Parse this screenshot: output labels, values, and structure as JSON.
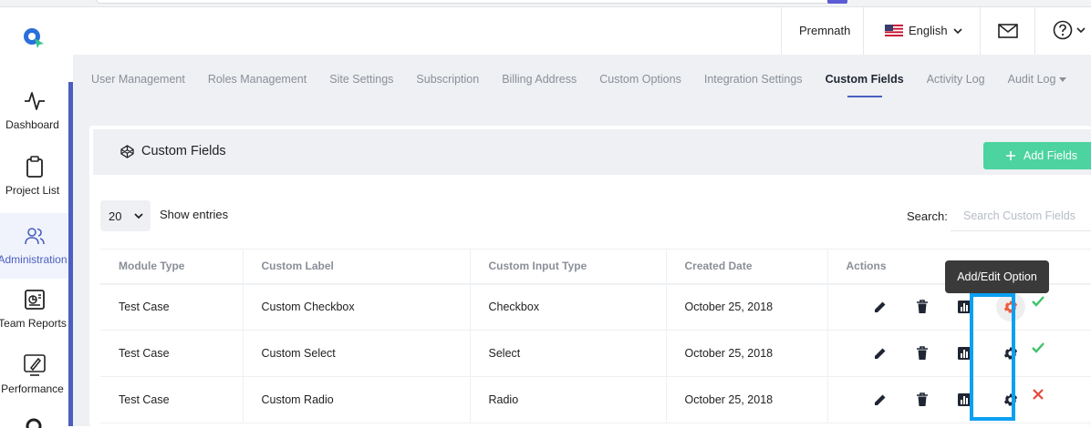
{
  "header": {
    "user_name": "Premnath",
    "language": "English"
  },
  "sidebar": {
    "items": [
      {
        "label": "Dashboard",
        "icon": "activity-icon"
      },
      {
        "label": "Project List",
        "icon": "clipboard-icon"
      },
      {
        "label": "Administration",
        "icon": "users-icon",
        "active": true
      },
      {
        "label": "Team Reports",
        "icon": "report-icon"
      },
      {
        "label": "Performance",
        "icon": "rocket-icon"
      }
    ]
  },
  "tabs": [
    {
      "label": "User Management"
    },
    {
      "label": "Roles Management"
    },
    {
      "label": "Site Settings"
    },
    {
      "label": "Subscription"
    },
    {
      "label": "Billing Address"
    },
    {
      "label": "Custom Options"
    },
    {
      "label": "Integration Settings"
    },
    {
      "label": "Custom Fields",
      "active": true
    },
    {
      "label": "Activity Log"
    },
    {
      "label": "Audit Log"
    }
  ],
  "card": {
    "title": "Custom Fields",
    "add_button": "Add Fields",
    "entries_value": "20",
    "entries_label": "Show entries",
    "search_label": "Search:",
    "search_placeholder": "Search Custom Fields"
  },
  "table": {
    "columns": [
      "Module Type",
      "Custom Label",
      "Custom Input Type",
      "Created Date",
      "Actions"
    ],
    "rows": [
      {
        "module": "Test Case",
        "label": "Custom Checkbox",
        "type": "Checkbox",
        "date": "October 25, 2018",
        "status": "check"
      },
      {
        "module": "Test Case",
        "label": "Custom Select",
        "type": "Select",
        "date": "October 25, 2018",
        "status": "check"
      },
      {
        "module": "Test Case",
        "label": "Custom Radio",
        "type": "Radio",
        "date": "October 25, 2018",
        "status": "cross"
      }
    ]
  },
  "tooltip": {
    "text": "Add/Edit Option"
  },
  "colors": {
    "accent": "#4a5fc1",
    "add_button": "#4cd3a0",
    "highlight": "#0aa0f2",
    "gear_hover": "#f05a3c",
    "check": "#3cc468",
    "cross": "#e5483a"
  }
}
